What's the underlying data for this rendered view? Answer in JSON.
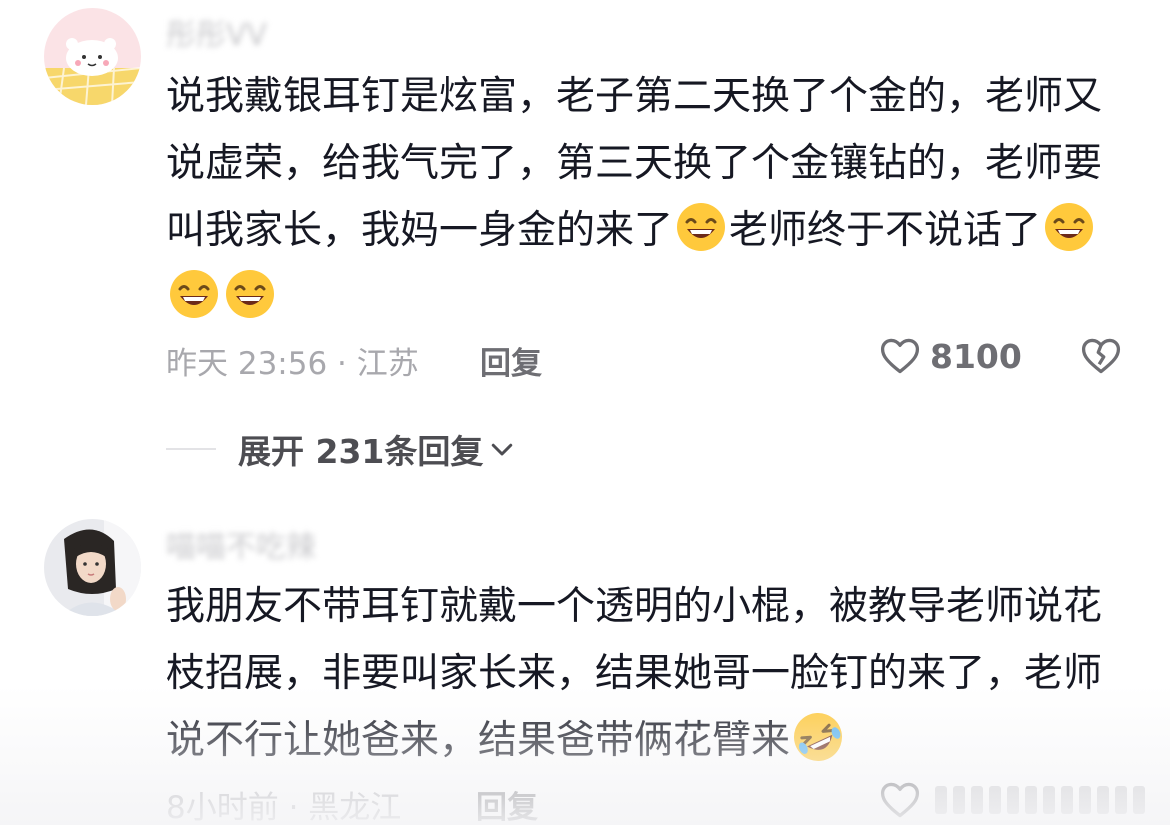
{
  "comments": [
    {
      "username": "彤彤VV",
      "lines": [
        "说我戴银耳钉是炫富，老子第二天换了个金的，老师又",
        "说虚荣，给我气完了，第三天换了个金镶钻的，老师要",
        "叫我家长，我妈一身金的来了",
        "老师终于不说话了"
      ],
      "time": "昨天 23:56 · 江苏",
      "reply_label": "回复",
      "likes": "8100"
    },
    {
      "username": "喵喵不吃辣",
      "lines": [
        "我朋友不带耳钉就戴一个透明的小棍，被教导老师说花",
        "枝招展，非要叫家长来，结果她哥一脸钉的来了，老师",
        "说不行让她爸来，结果爸带俩花臂来"
      ],
      "time": "8小时前 · 黑龙江",
      "reply_label": "回复"
    }
  ],
  "expand_replies": "展开 231条回复",
  "icons": {
    "like": "heart-outline-icon",
    "dislike": "broken-heart-icon",
    "emoji_smile": "grinning-sweat-emoji",
    "emoji_laugh": "rolling-laughing-emoji",
    "chevron": "chevron-down-icon"
  },
  "colors": {
    "text": "#161823",
    "meta": "#a8a8ad",
    "emoji_yellow": "#ffc93c"
  }
}
